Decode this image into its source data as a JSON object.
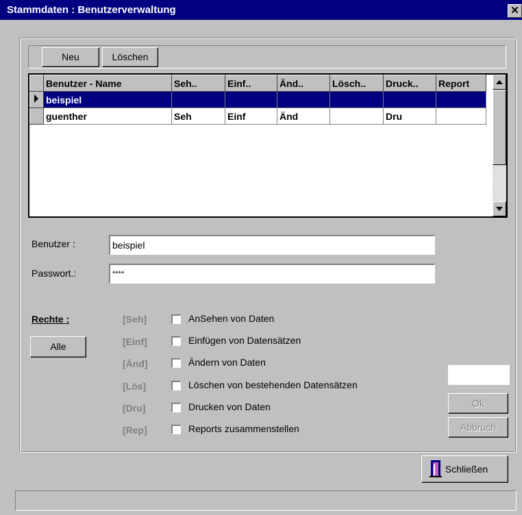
{
  "window": {
    "title": "Stammdaten : Benutzerverwaltung",
    "close_label": "✕"
  },
  "toolbar": {
    "new_label": "Neu",
    "delete_label": "Löschen"
  },
  "grid": {
    "columns": [
      "Benutzer - Name",
      "Seh..",
      "Einf..",
      "Änd..",
      "Lösch..",
      "Druck..",
      "Report"
    ],
    "rows": [
      {
        "name": "beispiel",
        "seh": "",
        "einf": "",
        "aend": "",
        "loesch": "",
        "druck": "",
        "report": "",
        "selected": true
      },
      {
        "name": "guenther",
        "seh": "Seh",
        "einf": "Einf",
        "aend": "Änd",
        "loesch": "",
        "druck": "Dru",
        "report": "",
        "selected": false
      }
    ]
  },
  "form": {
    "user_label": "Benutzer :",
    "user_value": "beispiel",
    "password_label": "Passwort.:",
    "password_value": "****"
  },
  "rights": {
    "heading": "Rechte :",
    "all_button": "Alle",
    "items": [
      {
        "tag": "[Seh]",
        "label": "AnSehen von Daten",
        "checked": false
      },
      {
        "tag": "[Einf]",
        "label": "Einfügen von Datensätzen",
        "checked": false
      },
      {
        "tag": "[Änd]",
        "label": "Ändern von Daten",
        "checked": false
      },
      {
        "tag": "[Lös]",
        "label": "Löschen von bestehenden Datensätzen",
        "checked": false
      },
      {
        "tag": "[Dru]",
        "label": "Drucken von Daten",
        "checked": false
      },
      {
        "tag": "[Rep]",
        "label": "Reports zusammenstellen",
        "checked": false
      }
    ]
  },
  "actions": {
    "ok_label": "Ok",
    "cancel_label": "Abbruch",
    "close_label": "Schließen"
  },
  "colors": {
    "title_bar": "#000080",
    "selection": "#000080",
    "face": "#c0c0c0"
  },
  "icons": {
    "close": "close-icon",
    "exit": "door-exit-icon",
    "row_pointer": "row-pointer-icon"
  }
}
